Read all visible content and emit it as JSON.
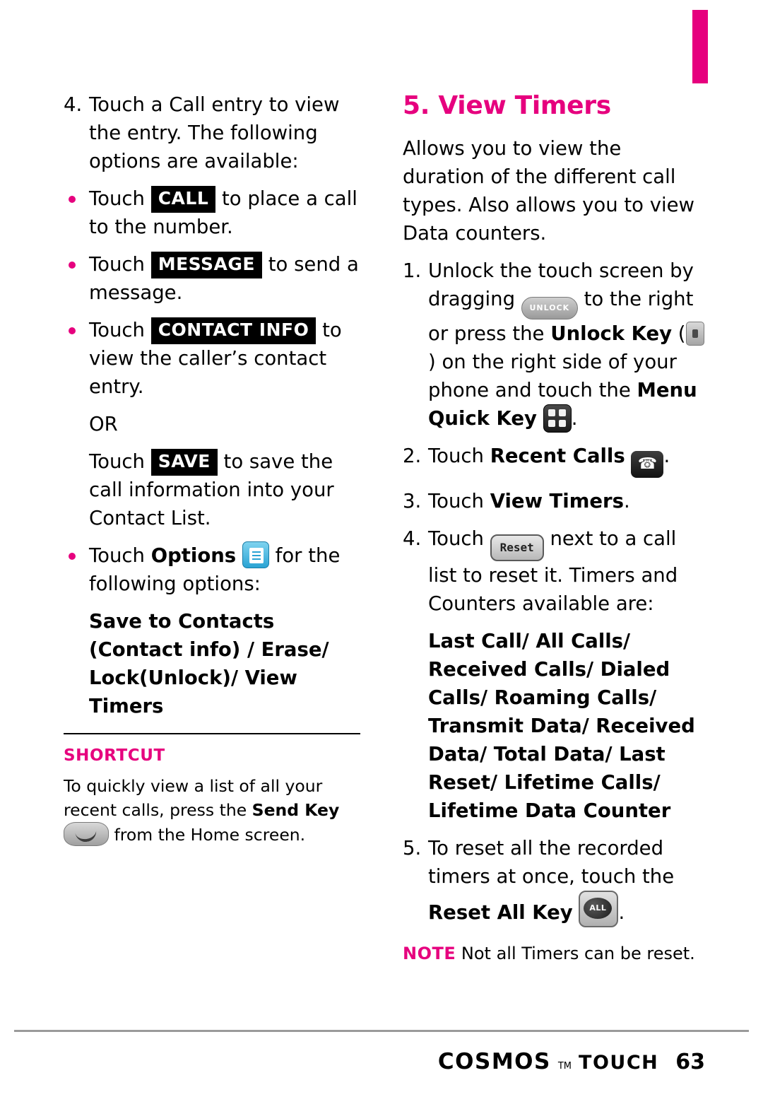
{
  "page": {
    "number": "63",
    "brand": "COSMOS",
    "brand_tm": "TM",
    "brand_sub": "TOUCH"
  },
  "left_column": {
    "step4": {
      "num": "4.",
      "text": "Touch a Call entry to view the entry. The following options are available:"
    },
    "bullets": [
      {
        "pre": "Touch",
        "key": "CALL",
        "post": "to place a call to the number."
      },
      {
        "pre": "Touch",
        "key": "MESSAGE",
        "post": "to send a message."
      },
      {
        "pre": "Touch",
        "key": "CONTACT INFO",
        "post": "to view the caller’s contact entry."
      }
    ],
    "or_text": "OR",
    "save_line": {
      "pre": "Touch",
      "key": "SAVE",
      "post": "to save the call information into your Contact List."
    },
    "options_bullet": {
      "pre": "Touch",
      "bold": "Options",
      "icon": "options-list-icon",
      "post": "for the following options:"
    },
    "options_list": "Save to Contacts (Contact info) / Erase/ Lock(Unlock)/ View Timers",
    "shortcut": {
      "title": "SHORTCUT",
      "part1": "To quickly view a list of all your recent calls, press the ",
      "bold": "Send Key",
      "icon": "send-key-icon",
      "part2": "from the Home screen."
    }
  },
  "right_column": {
    "heading": "5. View Timers",
    "intro": "Allows you to view the duration of the different call types. Also allows you to view Data counters.",
    "step1": {
      "num": "1.",
      "part1": "Unlock the touch screen by dragging",
      "icon1": "unlock-slider-icon",
      "icon1_label": "UNLOCK",
      "part2": "to the right or press the",
      "bold1": "Unlock Key",
      "paren_open": "(",
      "icon2": "unlock-key-icon",
      "paren_close": ")",
      "part3": "on the right side of your phone and touch the",
      "bold2": "Menu Quick Key",
      "icon3": "menu-quick-key-icon",
      "part4": "."
    },
    "step2": {
      "num": "2.",
      "pre": "Touch",
      "bold": "Recent Calls",
      "icon": "recent-calls-icon",
      "post": "."
    },
    "step3": {
      "num": "3.",
      "pre": "Touch",
      "bold": "View Timers",
      "post": "."
    },
    "step4": {
      "num": "4.",
      "pre": "Touch",
      "icon": "reset-button-icon",
      "icon_label": "Reset",
      "post": "next to a call list to reset it. Timers and Counters available are:"
    },
    "timers_list": "Last Call/ All Calls/ Received Calls/ Dialed Calls/ Roaming Calls/ Transmit Data/ Received Data/ Total Data/ Last Reset/ Lifetime Calls/ Lifetime Data Counter",
    "step5": {
      "num": "5.",
      "pre": "To reset all the recorded timers at once, touch the",
      "bold": "Reset All Key",
      "icon": "reset-all-key-icon",
      "post": "."
    },
    "note": {
      "label": "NOTE",
      "text": "Not all Timers can be reset."
    }
  },
  "colors": {
    "accent": "#e6007e",
    "text": "#000000"
  }
}
